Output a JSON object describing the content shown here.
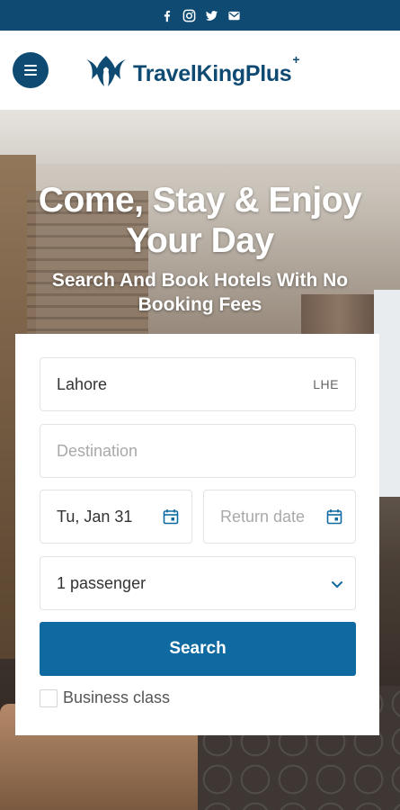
{
  "social": {
    "icons": [
      "facebook-icon",
      "instagram-icon",
      "twitter-icon",
      "email-icon"
    ]
  },
  "brand": {
    "name": "TravelKingPlus",
    "plus_mark": "+",
    "color": "#0f4a73"
  },
  "hero": {
    "title": "Come, Stay & Enjoy Your Day",
    "subtitle": "Search And Book Hotels With No Booking Fees"
  },
  "form": {
    "origin": {
      "value": "Lahore",
      "code": "LHE"
    },
    "destination": {
      "placeholder": "Destination"
    },
    "depart_date": {
      "value": "Tu, Jan 31"
    },
    "return_date": {
      "placeholder": "Return date"
    },
    "passengers": {
      "value": "1 passenger"
    },
    "search_label": "Search",
    "business_class_label": "Business class",
    "accent": "#0f6aa1"
  }
}
